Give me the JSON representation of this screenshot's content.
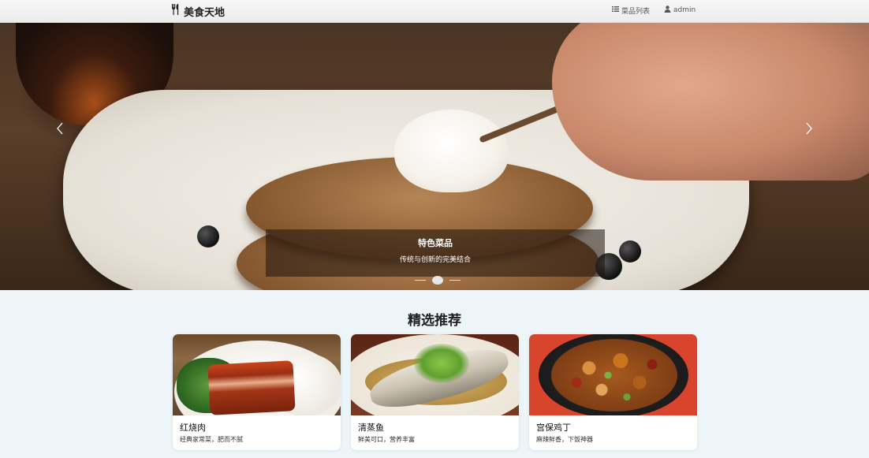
{
  "navbar": {
    "brand": "美食天地",
    "brand_icon": "utensils-icon",
    "links": [
      {
        "label": "菜品列表",
        "icon": "list-icon"
      },
      {
        "label": "admin",
        "icon": "user-icon"
      }
    ]
  },
  "carousel": {
    "caption_title": "特色菜品",
    "caption_subtitle": "传统与创新的完美结合",
    "slide_count": 3,
    "active_slide": 2
  },
  "featured": {
    "title": "精选推荐",
    "dishes": [
      {
        "name": "红烧肉",
        "description": "经典家常菜，肥而不腻"
      },
      {
        "name": "清蒸鱼",
        "description": "鲜美可口，营养丰富"
      },
      {
        "name": "宫保鸡丁",
        "description": "麻辣鲜香，下饭神器"
      }
    ]
  }
}
